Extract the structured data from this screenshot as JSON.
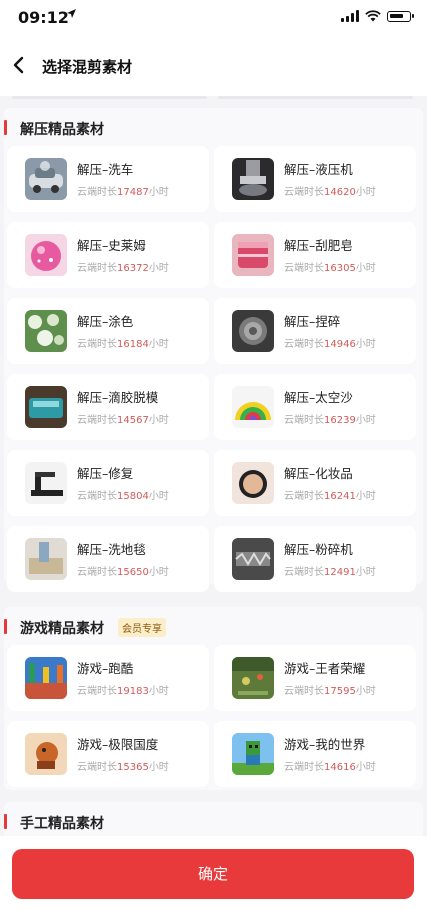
{
  "status_bar": {
    "time": "09:12"
  },
  "nav": {
    "title": "选择混剪素材"
  },
  "meta_prefix": "云端时长",
  "meta_suffix": "小时",
  "sections": [
    {
      "title": "解压精品素材",
      "items": [
        {
          "title": "解压–洗车",
          "hours": "17487"
        },
        {
          "title": "解压–液压机",
          "hours": "14620"
        },
        {
          "title": "解压–史莱姆",
          "hours": "16372"
        },
        {
          "title": "解压–刮肥皂",
          "hours": "16305"
        },
        {
          "title": "解压–涂色",
          "hours": "16184"
        },
        {
          "title": "解压–捏碎",
          "hours": "14946"
        },
        {
          "title": "解压–滴胶脱模",
          "hours": "14567"
        },
        {
          "title": "解压–太空沙",
          "hours": "16239"
        },
        {
          "title": "解压–修复",
          "hours": "15804"
        },
        {
          "title": "解压–化妆品",
          "hours": "16241"
        },
        {
          "title": "解压–洗地毯",
          "hours": "15650"
        },
        {
          "title": "解压–粉碎机",
          "hours": "12491"
        }
      ]
    },
    {
      "title": "游戏精品素材",
      "badge": "会员专享",
      "items": [
        {
          "title": "游戏–跑酷",
          "hours": "19183"
        },
        {
          "title": "游戏–王者荣耀",
          "hours": "17595"
        },
        {
          "title": "游戏–极限国度",
          "hours": "15365"
        },
        {
          "title": "游戏–我的世界",
          "hours": "14616"
        }
      ]
    },
    {
      "title": "手工精品素材",
      "items": []
    }
  ],
  "confirm_label": "确定"
}
